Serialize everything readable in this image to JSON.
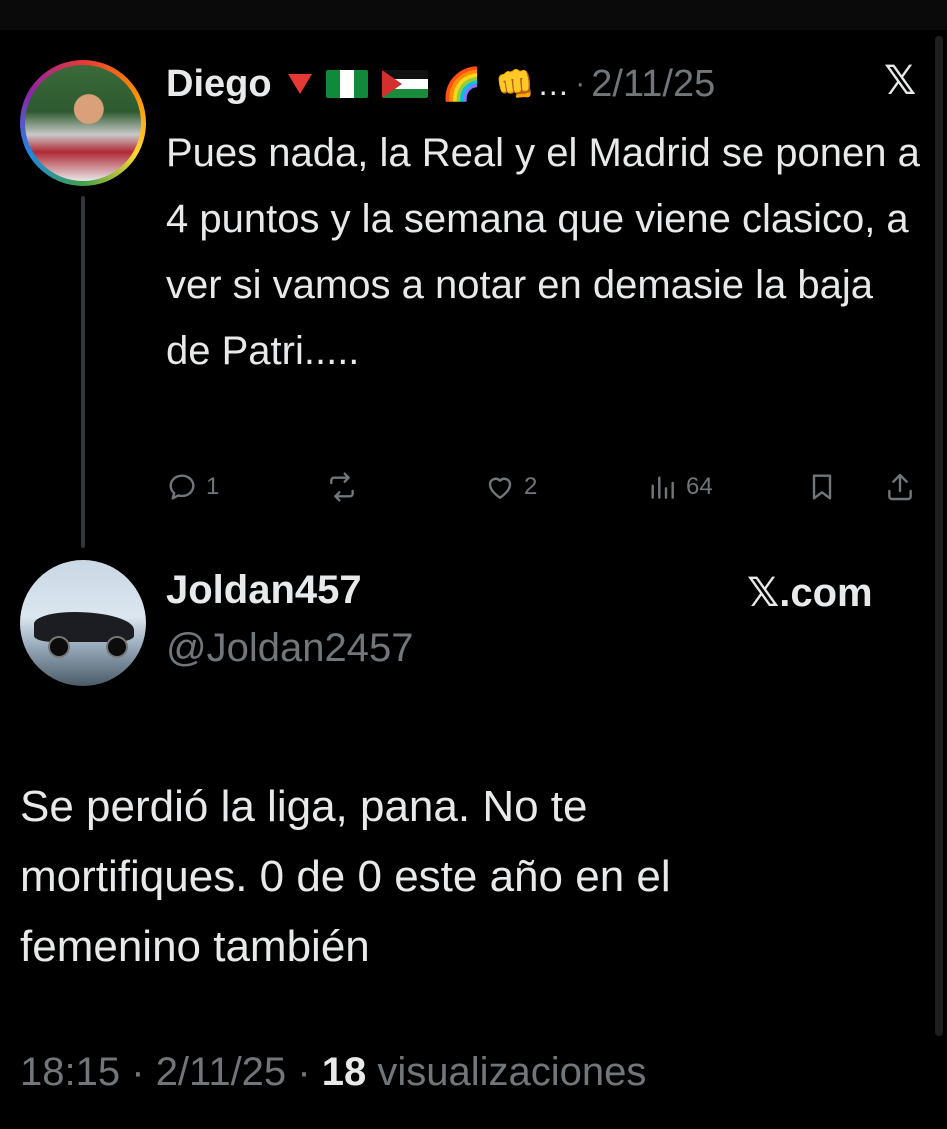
{
  "parent": {
    "name": "Diego",
    "name_emojis": [
      "down-triangle-red",
      "flag-nigeria",
      "flag-palestine",
      "rainbow",
      "fist"
    ],
    "ellipsis": "…",
    "separator": "·",
    "date": "2/11/25",
    "platform_icon": "x-logo",
    "text": "Pues nada, la Real y el Madrid se ponen a 4 puntos y la semana que viene clasico, a ver si vamos a notar en demasie la baja de Patri.....",
    "actions": {
      "replies": "1",
      "reposts": "",
      "likes": "2",
      "views": "64"
    }
  },
  "reply": {
    "name": "Joldan457",
    "handle": "@Joldan2457",
    "source_label": "𝕏.com",
    "text_lines": [
      "Se perdió la liga, pana. No te",
      "mortifiques. 0 de 0 este año en el",
      "femenino también"
    ],
    "time": "18:15",
    "sep1": "·",
    "date": "2/11/25",
    "sep2": "·",
    "views_count": "18",
    "views_label": "visualizaciones"
  },
  "colors": {
    "background": "#000000",
    "text_primary": "#e7e9ea",
    "text_secondary": "#71767b"
  }
}
